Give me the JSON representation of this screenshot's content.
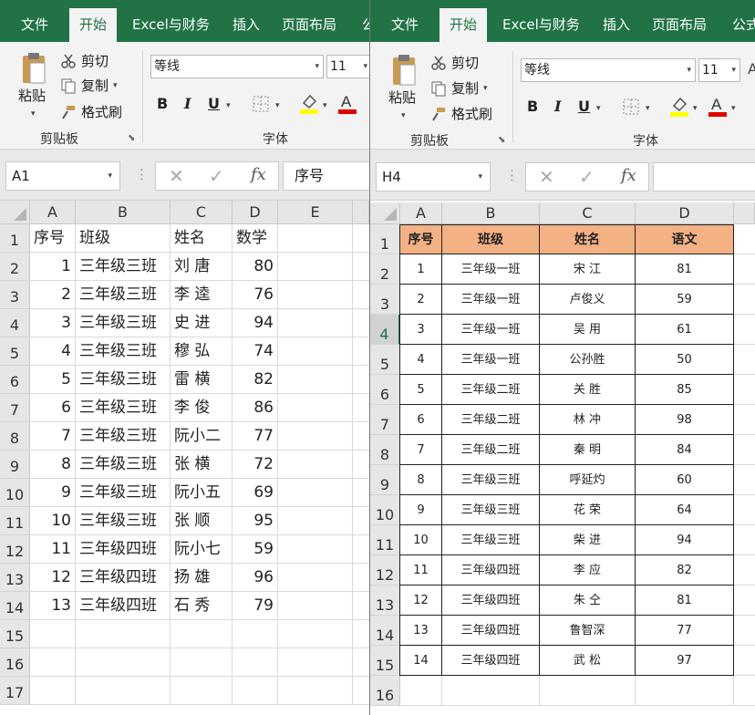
{
  "left": {
    "tabs": [
      "文件",
      "开始",
      "Excel与财务",
      "插入",
      "页面布局",
      "公式"
    ],
    "active_tab": "开始",
    "clipboard": {
      "paste": "粘贴",
      "cut": "剪切",
      "copy": "复制",
      "format_painter": "格式刷",
      "group": "剪贴板"
    },
    "font": {
      "name": "等线",
      "size": "11",
      "group": "字体"
    },
    "name_box": "A1",
    "formula": "序号",
    "columns": [
      "A",
      "B",
      "C",
      "D",
      "E"
    ],
    "row_numbers": [
      "1",
      "2",
      "3",
      "4",
      "5",
      "6",
      "7",
      "8",
      "9",
      "10",
      "11",
      "12",
      "13",
      "14",
      "15",
      "16",
      "17"
    ],
    "header": [
      "序号",
      "班级",
      "姓名",
      "数学"
    ],
    "rows": [
      [
        "1",
        "三年级三班",
        "刘  唐",
        "80"
      ],
      [
        "2",
        "三年级三班",
        "李  逵",
        "76"
      ],
      [
        "3",
        "三年级三班",
        "史  进",
        "94"
      ],
      [
        "4",
        "三年级三班",
        "穆  弘",
        "74"
      ],
      [
        "5",
        "三年级三班",
        "雷  横",
        "82"
      ],
      [
        "6",
        "三年级三班",
        "李  俊",
        "86"
      ],
      [
        "7",
        "三年级三班",
        "阮小二",
        "77"
      ],
      [
        "8",
        "三年级三班",
        "张  横",
        "72"
      ],
      [
        "9",
        "三年级三班",
        "阮小五",
        "69"
      ],
      [
        "10",
        "三年级三班",
        "张  顺",
        "95"
      ],
      [
        "11",
        "三年级四班",
        "阮小七",
        "59"
      ],
      [
        "12",
        "三年级四班",
        "扬  雄",
        "96"
      ],
      [
        "13",
        "三年级四班",
        "石  秀",
        "79"
      ]
    ]
  },
  "right": {
    "tabs": [
      "文件",
      "开始",
      "Excel与财务",
      "插入",
      "页面布局",
      "公式"
    ],
    "active_tab": "开始",
    "clipboard": {
      "paste": "粘贴",
      "cut": "剪切",
      "copy": "复制",
      "format_painter": "格式刷",
      "group": "剪贴板"
    },
    "font": {
      "name": "等线",
      "size": "11",
      "group": "字体"
    },
    "name_box": "H4",
    "formula": "",
    "columns": [
      "A",
      "B",
      "C",
      "D"
    ],
    "row_numbers": [
      "1",
      "2",
      "3",
      "4",
      "5",
      "6",
      "7",
      "8",
      "9",
      "10",
      "11",
      "12",
      "13",
      "14",
      "15",
      "16"
    ],
    "selected_row": "4",
    "header": [
      "序号",
      "班级",
      "姓名",
      "语文"
    ],
    "header_fill": "#f4b183",
    "rows": [
      [
        "1",
        "三年级一班",
        "宋    江",
        "81"
      ],
      [
        "2",
        "三年级一班",
        "卢俊义",
        "59"
      ],
      [
        "3",
        "三年级一班",
        "吴    用",
        "61"
      ],
      [
        "4",
        "三年级一班",
        "公孙胜",
        "50"
      ],
      [
        "5",
        "三年级二班",
        "关    胜",
        "85"
      ],
      [
        "6",
        "三年级二班",
        "林    冲",
        "98"
      ],
      [
        "7",
        "三年级二班",
        "秦    明",
        "84"
      ],
      [
        "8",
        "三年级三班",
        "呼延灼",
        "60"
      ],
      [
        "9",
        "三年级三班",
        "花    荣",
        "64"
      ],
      [
        "10",
        "三年级三班",
        "柴    进",
        "94"
      ],
      [
        "11",
        "三年级四班",
        "李    应",
        "82"
      ],
      [
        "12",
        "三年级四班",
        "朱    仝",
        "81"
      ],
      [
        "13",
        "三年级四班",
        "鲁智深",
        "77"
      ],
      [
        "14",
        "三年级四班",
        "武    松",
        "97"
      ]
    ]
  },
  "theme": {
    "ribbon_green": "#217346",
    "grid_line": "#d9d9d9"
  },
  "icons": [
    "paste-icon",
    "scissors-icon",
    "copy-icon",
    "format-painter-icon",
    "bold-icon",
    "italic-icon",
    "underline-icon",
    "borders-icon",
    "fill-color-icon",
    "font-color-icon",
    "cancel-icon",
    "enter-icon",
    "function-icon"
  ]
}
